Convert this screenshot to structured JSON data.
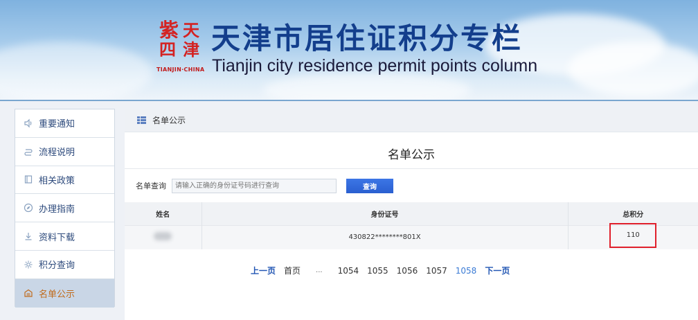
{
  "header": {
    "seal_chars": [
      "天",
      "津",
      "紫",
      "四"
    ],
    "seal_caption": "TIANJIN·CHINA",
    "title_cn": "天津市居住证积分专栏",
    "title_en": "Tianjin city residence permit points column"
  },
  "sidebar": {
    "items": [
      {
        "label": "重要通知",
        "icon": "speaker-icon"
      },
      {
        "label": "流程说明",
        "icon": "flow-icon"
      },
      {
        "label": "相关政策",
        "icon": "document-icon"
      },
      {
        "label": "办理指南",
        "icon": "compass-icon"
      },
      {
        "label": "资料下载",
        "icon": "download-icon"
      },
      {
        "label": "积分查询",
        "icon": "gear-icon"
      },
      {
        "label": "名单公示",
        "icon": "building-icon"
      }
    ],
    "active_index": 6
  },
  "main": {
    "breadcrumb": "名单公示",
    "title": "名单公示",
    "query_label": "名单查询",
    "query_placeholder": "请输入正确的身份证号码进行查询",
    "query_button": "查询",
    "table": {
      "headers": [
        "姓名",
        "身份证号",
        "总积分"
      ],
      "rows": [
        {
          "name": "",
          "id": "430822********801X",
          "points": "110"
        }
      ]
    },
    "pager": {
      "prev": "上一页",
      "first": "首页",
      "ellipsis": "...",
      "pages": [
        "1054",
        "1055",
        "1056",
        "1057",
        "1058"
      ],
      "current": "1058",
      "next": "下一页"
    }
  },
  "colors": {
    "brand_blue": "#133e8c",
    "seal_red": "#d42222",
    "active_orange": "#c06a1b",
    "highlight_red": "#e01f2b",
    "button_blue": "#2a5fd0"
  }
}
